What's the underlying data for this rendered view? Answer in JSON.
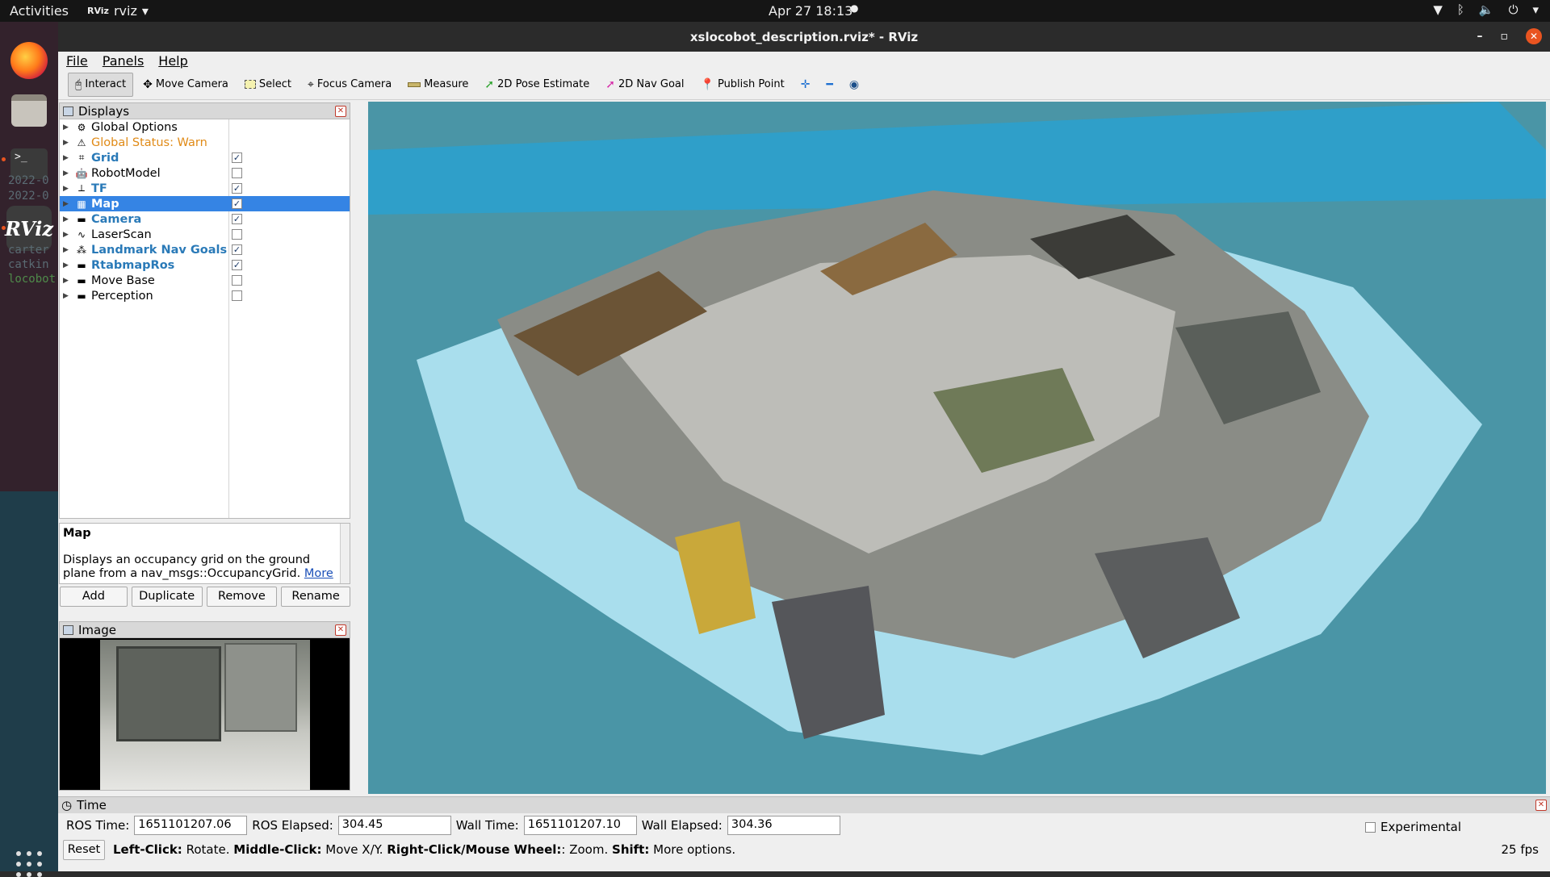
{
  "topbar": {
    "activities": "Activities",
    "app_name": "rviz",
    "app_logo": "RViz",
    "clock": "Apr 27  18:13"
  },
  "dock": {
    "term_lines": [
      "2022-0",
      "2022-0",
      "carter",
      "catkin",
      "locobot"
    ]
  },
  "window": {
    "title": "xslocobot_description.rviz* - RViz"
  },
  "menu": [
    "File",
    "Panels",
    "Help"
  ],
  "toolbar": {
    "interact": "Interact",
    "move_camera": "Move Camera",
    "select": "Select",
    "focus_camera": "Focus Camera",
    "measure": "Measure",
    "pose_estimate": "2D Pose Estimate",
    "nav_goal": "2D Nav Goal",
    "publish_point": "Publish Point"
  },
  "displays": {
    "title": "Displays",
    "items": [
      {
        "label": "Global Options",
        "style": "normal",
        "checked": null,
        "icon": "gear-icon"
      },
      {
        "label": "Global Status: Warn",
        "style": "warn",
        "checked": null,
        "icon": "warning-icon"
      },
      {
        "label": "Grid",
        "style": "blue",
        "checked": true,
        "icon": "grid-icon"
      },
      {
        "label": "RobotModel",
        "style": "normal",
        "checked": false,
        "icon": "robot-icon"
      },
      {
        "label": "TF",
        "style": "blue",
        "checked": true,
        "icon": "axes-icon"
      },
      {
        "label": "Map",
        "style": "selected",
        "checked": true,
        "icon": "map-icon"
      },
      {
        "label": "Camera",
        "style": "blue",
        "checked": true,
        "icon": "folder-icon"
      },
      {
        "label": "LaserScan",
        "style": "normal",
        "checked": false,
        "icon": "laserscan-icon"
      },
      {
        "label": "Landmark Nav Goals",
        "style": "blue",
        "checked": true,
        "icon": "markers-icon"
      },
      {
        "label": "RtabmapRos",
        "style": "blue",
        "checked": true,
        "icon": "folder-icon"
      },
      {
        "label": "Move Base",
        "style": "normal",
        "checked": false,
        "icon": "folder-icon"
      },
      {
        "label": "Perception",
        "style": "normal",
        "checked": false,
        "icon": "folder-icon"
      }
    ]
  },
  "description": {
    "title": "Map",
    "text": "Displays an occupancy grid on the ground plane from a nav_msgs::OccupancyGrid.",
    "link": "More"
  },
  "buttons": {
    "add": "Add",
    "duplicate": "Duplicate",
    "remove": "Remove",
    "rename": "Rename"
  },
  "image_panel": {
    "title": "Image"
  },
  "time": {
    "title": "Time",
    "ros_time_label": "ROS Time:",
    "ros_time": "1651101207.06",
    "ros_elapsed_label": "ROS Elapsed:",
    "ros_elapsed": "304.45",
    "wall_time_label": "Wall Time:",
    "wall_time": "1651101207.10",
    "wall_elapsed_label": "Wall Elapsed:",
    "wall_elapsed": "304.36",
    "experimental": "Experimental"
  },
  "status": {
    "reset": "Reset",
    "left_click_key": "Left-Click:",
    "left_click": "Rotate.",
    "middle_click_key": "Middle-Click:",
    "middle_click": "Move X/Y.",
    "right_click_key": "Right-Click/Mouse Wheel:",
    "right_click": ": Zoom.",
    "shift_key": "Shift:",
    "shift": "More options.",
    "fps": "25 fps"
  },
  "colors": {
    "viewport_bg": "#4a95a6",
    "free_space": "#b4e6f5",
    "selection": "#3584e4",
    "accent": "#e95420"
  }
}
